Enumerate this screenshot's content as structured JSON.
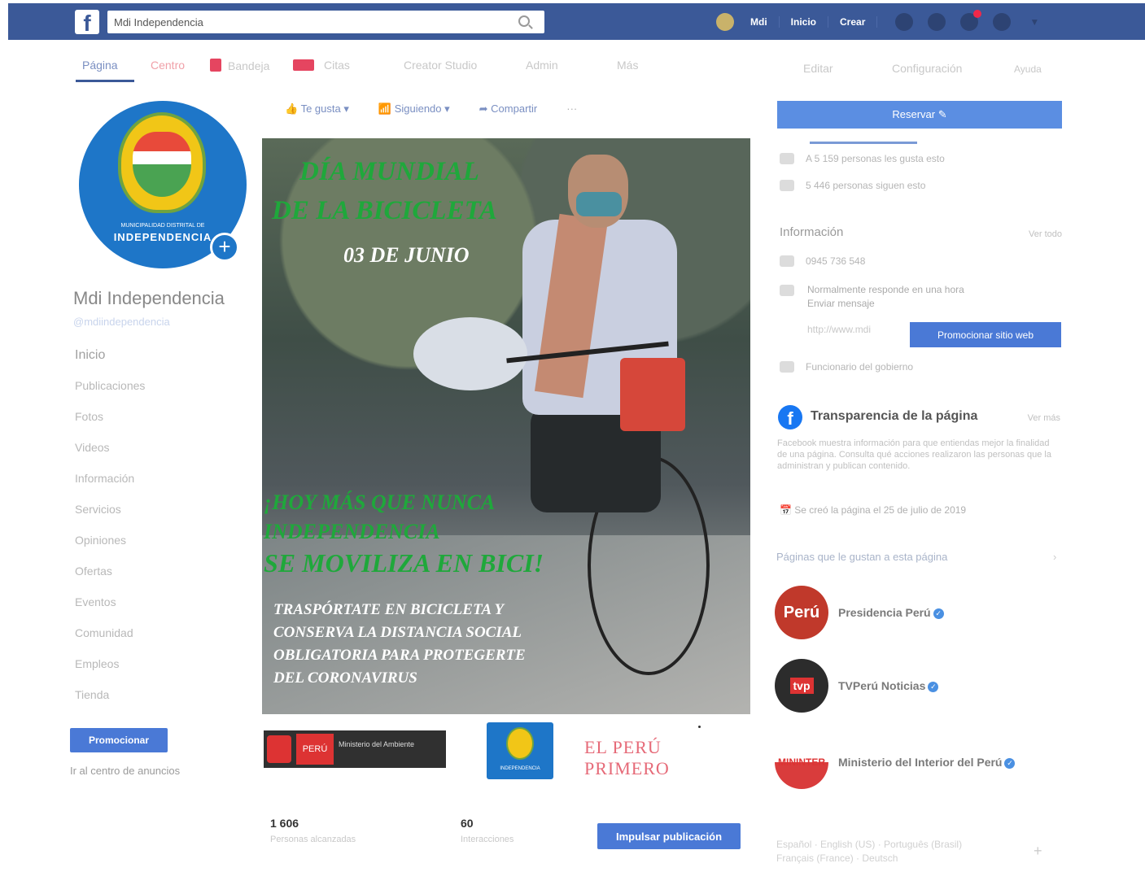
{
  "topbar": {
    "logo": "f",
    "search_value": "Mdi Independencia",
    "profile_name": "Mdi",
    "home_label": "Inicio",
    "create_label": "Crear",
    "icons": [
      "friends-icon",
      "messenger-icon",
      "bell-icon",
      "help-icon",
      "chevron-down-icon"
    ],
    "color": "#3b5998"
  },
  "page_nav": {
    "items": [
      "Página",
      "Centro",
      "Bandeja",
      "Citas",
      "Creator Studio",
      "Admin",
      "Más"
    ],
    "right": [
      "Editar",
      "Configuración",
      "Ayuda"
    ]
  },
  "profile": {
    "small_text": "MUNICIPALIDAD DISTRITAL DE",
    "logo_text": "INDEPENDENCIA",
    "name": "Mdi Independencia",
    "handle": "@mdiindependencia"
  },
  "sidebar": {
    "items": [
      "Inicio",
      "Publicaciones",
      "Fotos",
      "Videos",
      "Información",
      "Servicios",
      "Opiniones",
      "Ofertas",
      "Eventos",
      "Comunidad",
      "Empleos",
      "Tienda"
    ],
    "promote_label": "Promocionar",
    "ads_link": "Ir al centro de anuncios"
  },
  "actions": {
    "like": "Te gusta",
    "following": "Siguiendo",
    "share": "Compartir",
    "more": "···"
  },
  "post": {
    "title_line1": "DÍA MUNDIAL",
    "title_line2": "DE LA BICICLETA",
    "date": "03 DE JUNIO",
    "slogan_line1": "¡HOY MÁS QUE NUNCA",
    "slogan_line2": "INDEPENDENCIA",
    "slogan_line3": "SE MOVILIZA EN BICI!",
    "message_line1": "TRASPÓRTATE EN BICICLETA Y",
    "message_line2": "CONSERVA LA DISTANCIA SOCIAL",
    "message_line3": "OBLIGATORIA PARA PROTEGERTE",
    "message_line4": "DEL CORONAVIRUS",
    "logo_peru": "PERÚ",
    "logo_ministry": "Ministerio del Ambiente",
    "logo_mdi": "INDEPENDENCIA",
    "logo_slogan": "EL PERÚ PRIMERO"
  },
  "stats": {
    "reached_value": "1 606",
    "reached_label": "Personas alcanzadas",
    "interactions_value": "60",
    "interactions_label": "Interacciones",
    "boost_label": "Impulsar publicación"
  },
  "right": {
    "reserve_label": "Reservar",
    "likes_text": "A 5 159 personas les gusta esto",
    "follows_text": "5 446 personas siguen esto",
    "info_title": "Información",
    "edit_link": "Ver todo",
    "phone": "0945 736 548",
    "response_line1": "Normalmente responde en una hora",
    "response_line2": "Enviar mensaje",
    "url": "http://www.mdi",
    "promote_web_label": "Promocionar sitio web",
    "category": "Funcionario del gobierno",
    "transparency_title": "Transparencia de la página",
    "see_more": "Ver más",
    "transparency_desc": "Facebook muestra información para que entiendas mejor la finalidad de una página. Consulta qué acciones realizaron las personas que la administran y publican contenido.",
    "created": "Se creó la página el 25 de julio de 2019",
    "liked_title": "Páginas que le gustan a esta página",
    "liked_pages": [
      {
        "name": "Presidencia Perú",
        "avatar_text": "Perú"
      },
      {
        "name": "TVPerú Noticias",
        "avatar_text": "tvp"
      },
      {
        "name": "Ministerio del Interior del Perú",
        "avatar_text": "MININTER"
      }
    ],
    "languages_line1": "Español · English (US) · Português (Brasil)",
    "languages_line2": "Français (France) · Deutsch"
  }
}
